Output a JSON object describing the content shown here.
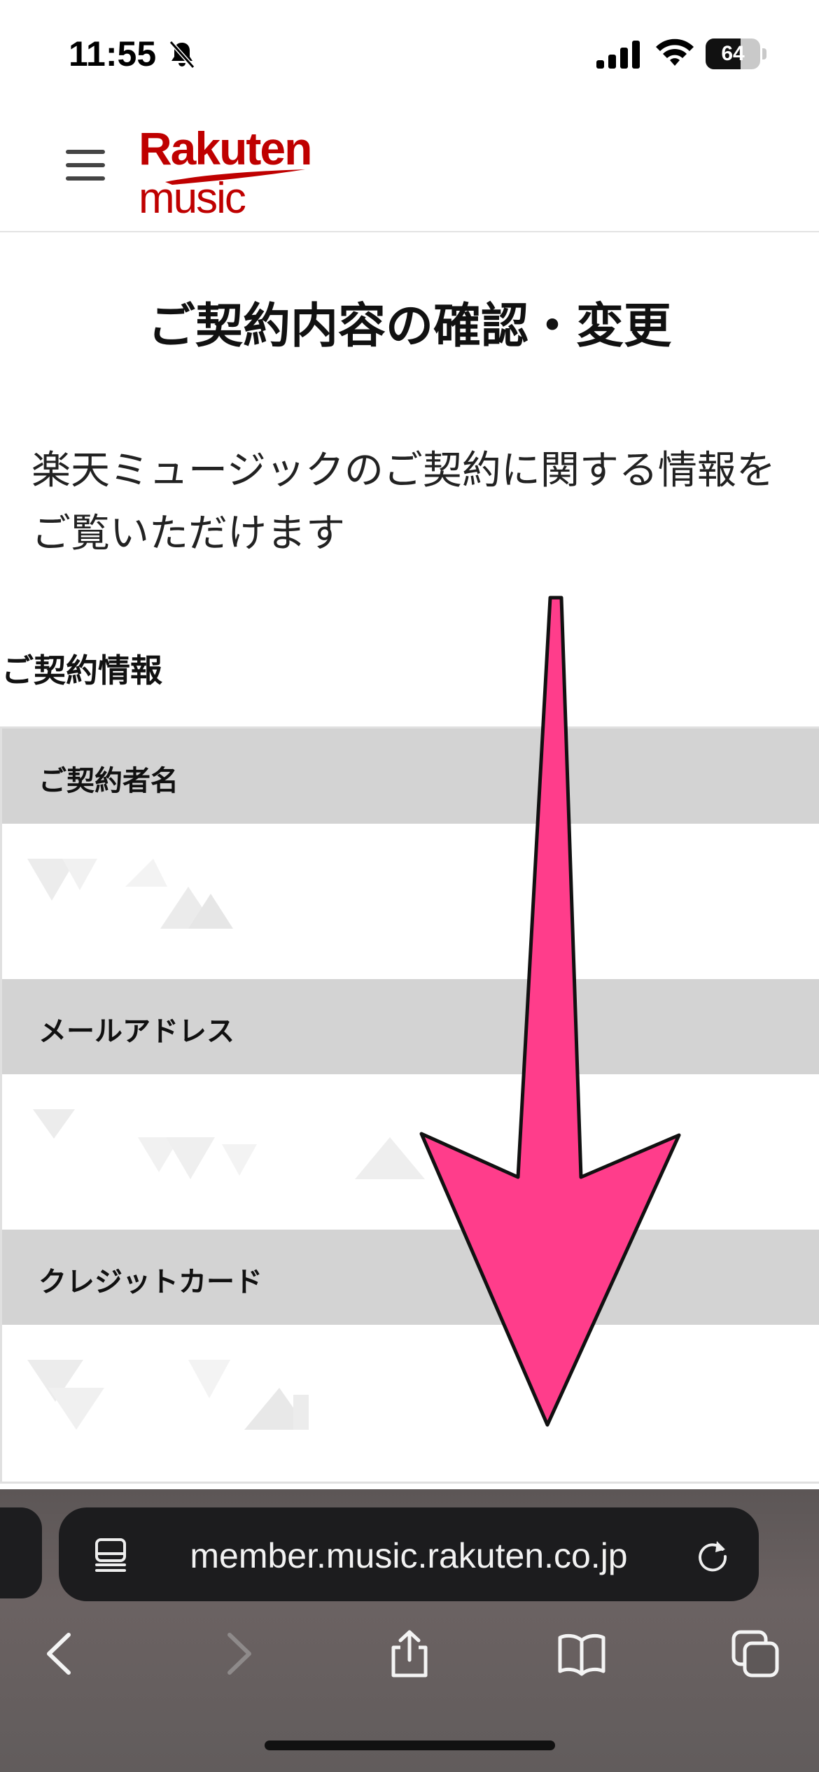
{
  "status_bar": {
    "time": "11:55",
    "battery_level": "64",
    "battery_fraction": 0.64,
    "icons": [
      "bell-slash-icon",
      "cellular-signal-icon",
      "wifi-icon",
      "battery-icon"
    ]
  },
  "header": {
    "logo_line1": "Rakuten",
    "logo_line2": "music",
    "brand_color": "#bf0000",
    "menu_icon": "hamburger-menu-icon"
  },
  "main": {
    "title": "ご契約内容の確認・変更",
    "intro": "楽天ミュージックのご契約に関する情報をご覧いただけます",
    "section_title": "ご契約情報",
    "rows": [
      {
        "label": "ご契約者名"
      },
      {
        "label": "メールアドレス"
      },
      {
        "label": "クレジットカード"
      }
    ]
  },
  "overlay": {
    "arrow_color": "#ff3d8b",
    "arrow_direction": "down"
  },
  "browser": {
    "url": "member.music.rakuten.co.jp",
    "icons": [
      "reader-icon",
      "reload-icon",
      "back-icon",
      "forward-icon",
      "share-icon",
      "bookmarks-icon",
      "tabs-icon"
    ]
  }
}
